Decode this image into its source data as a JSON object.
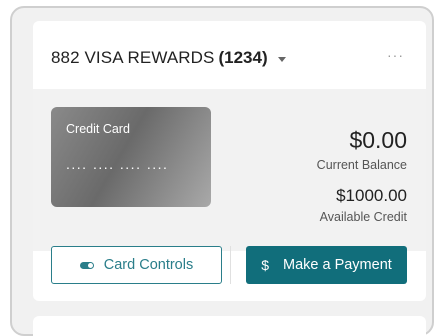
{
  "account": {
    "name": "882 VISA REWARDS",
    "number": "(1234)"
  },
  "card": {
    "label": "Credit Card",
    "masked_number": ".... .... .... ...."
  },
  "balance": {
    "current_value": "$0.00",
    "current_label": "Current Balance",
    "available_value": "$1000.00",
    "available_label": "Available Credit"
  },
  "actions": {
    "card_controls_label": "Card Controls",
    "payment_icon": "$",
    "payment_label": "Make a Payment"
  },
  "header": {
    "more_glyph": "···"
  },
  "colors": {
    "accent": "#116e7b",
    "outline_accent": "#2a7e8a"
  }
}
